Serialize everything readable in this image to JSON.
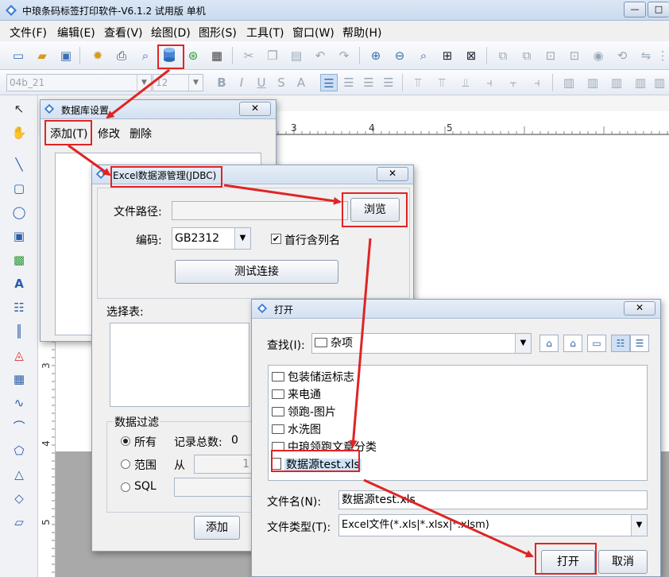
{
  "app": {
    "title": "中琅条码标签打印软件-V6.1.2 试用版 单机"
  },
  "window_buttons": {
    "minimize": "—",
    "maximize": "□"
  },
  "menu": [
    "文件(F)",
    "编辑(E)",
    "查看(V)",
    "绘图(D)",
    "图形(S)",
    "工具(T)",
    "窗口(W)",
    "帮助(H)"
  ],
  "format_bar": {
    "font_name": "04b_21",
    "font_size": "12"
  },
  "ruler": {
    "top": [
      "3",
      "4",
      "5"
    ],
    "left": [
      "3",
      "4",
      "5"
    ]
  },
  "db_dialog": {
    "title": "数据库设置",
    "close": "✕",
    "tabs": [
      "添加(T)",
      "修改",
      "删除"
    ]
  },
  "excel_dialog": {
    "title": "Excel数据源管理(JDBC)",
    "close": "✕",
    "path_label": "文件路径:",
    "path_value": "",
    "browse": "浏览",
    "encoding_label": "编码:",
    "encoding_value": "GB2312",
    "header_row_label": "首行含列名",
    "header_row_checked": true,
    "test_connection": "测试连接",
    "select_table_label": "选择表:",
    "filter_group": "数据过滤",
    "filter_all": "所有",
    "record_count_label": "记录总数:",
    "record_count_value": "0",
    "filter_range": "范围",
    "from_label": "从",
    "range_from_value": "1",
    "filter_sql": "SQL",
    "add": "添加"
  },
  "open_dialog": {
    "title": "打开",
    "close": "✕",
    "lookin_label": "查找(I):",
    "lookin_value": "杂项",
    "files": [
      {
        "name": "包装储运标志",
        "type": "folder"
      },
      {
        "name": "来电通",
        "type": "folder"
      },
      {
        "name": "领跑-图片",
        "type": "folder"
      },
      {
        "name": "水洗图",
        "type": "folder"
      },
      {
        "name": "中琅领跑文章分类",
        "type": "folder"
      },
      {
        "name": "数据源test.xls",
        "type": "file",
        "selected": true
      }
    ],
    "filename_label": "文件名(N):",
    "filename_value": "数据源test.xls",
    "filetype_label": "文件类型(T):",
    "filetype_value": "Excel文件(*.xls|*.xlsx|*.xlsm)",
    "open": "打开",
    "cancel": "取消"
  },
  "colors": {
    "highlight": "#e02424",
    "selection": "#cce4f7",
    "accent": "#2a5da8"
  }
}
